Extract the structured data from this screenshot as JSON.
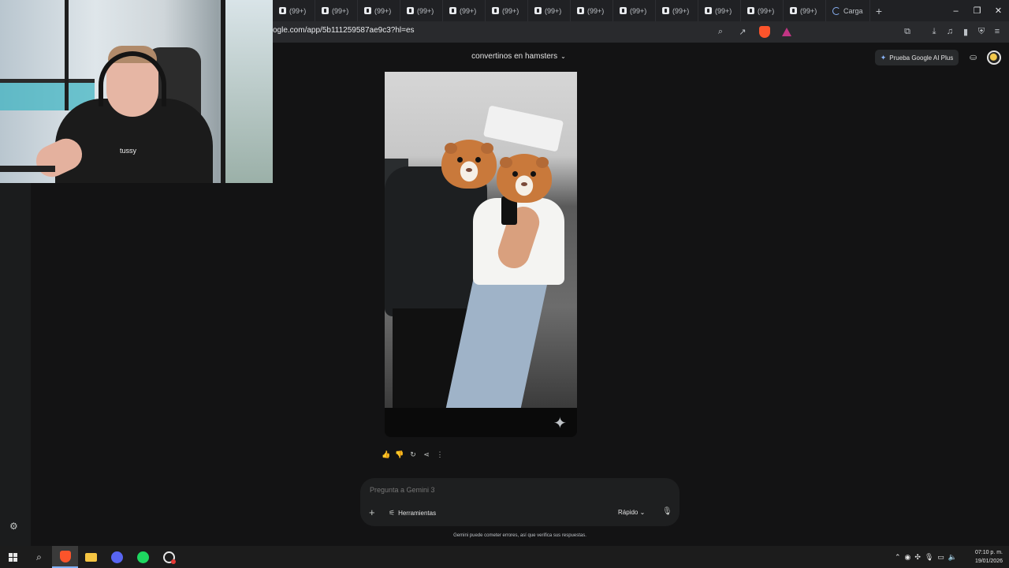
{
  "browser": {
    "tabs": [
      {
        "label": "(99+)"
      },
      {
        "label": "(99+)"
      },
      {
        "label": "(99+)"
      },
      {
        "label": "(99+)"
      },
      {
        "label": "(99+)"
      },
      {
        "label": "(99+)"
      },
      {
        "label": "(99+)"
      },
      {
        "label": "(99+)"
      },
      {
        "label": "(99+)"
      },
      {
        "label": "(99+)"
      },
      {
        "label": "(99+)"
      },
      {
        "label": "(99+)"
      },
      {
        "label": "(99+)"
      }
    ],
    "tab_icon": "tiktok-icon",
    "loading_tab_label": "Carga",
    "url": "ogle.com/app/5b111259587ae9c3?hl=es",
    "window_controls": {
      "minimize": "–",
      "restore": "❐",
      "close": "✕"
    },
    "accent": "#fb542b"
  },
  "gemini": {
    "chat_title": "convertinos en hamsters",
    "promo_label": "Prueba Google AI Plus",
    "prompt_placeholder": "Pregunta a Gemini 3",
    "tools_label": "Herramientas",
    "mode_label": "Rápido",
    "disclaimer": "Gemini puede cometer errores, así que verifica sus respuestas.",
    "generated_image_caption_hidden": ""
  },
  "webcam": {
    "shirt_text": "tussy"
  },
  "taskbar": {
    "time": "07:10 p. m.",
    "date": "19/01/2026"
  },
  "colors": {
    "background": "#131314",
    "composer": "#1e1f20",
    "taskbar": "#1c1c1c"
  }
}
